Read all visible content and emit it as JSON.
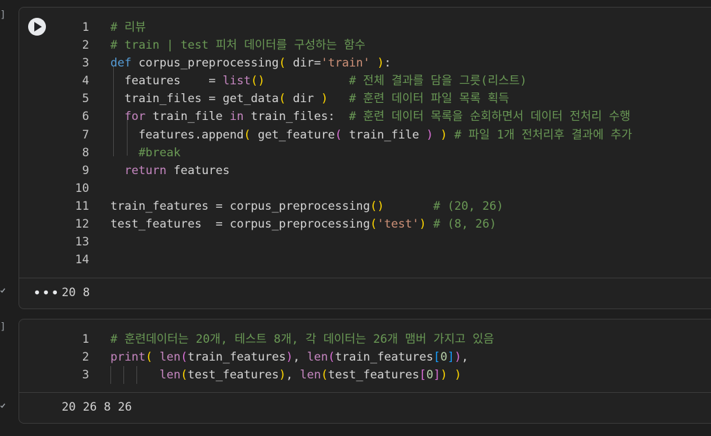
{
  "gutter": {
    "bracket": "]"
  },
  "cell1": {
    "lines": [
      {
        "n": "1",
        "t": "# 리뷰"
      },
      {
        "n": "2",
        "t": "# train | test 피처 데이터를 구성하는 함수"
      },
      {
        "n": "3",
        "t": "def corpus_preprocessing( dir='train' ):"
      },
      {
        "n": "4",
        "t": "  features    = list()            # 전체 결과를 담을 그릇(리스트)"
      },
      {
        "n": "5",
        "t": "  train_files = get_data( dir )   # 훈련 데이터 파일 목록 획득"
      },
      {
        "n": "6",
        "t": "  for train_file in train_files:  # 훈련 데이터 목록을 순회하면서 데이터 전처리 수행"
      },
      {
        "n": "7",
        "t": "    features.append( get_feature( train_file ) ) # 파일 1개 전처리후 결과에 추가"
      },
      {
        "n": "8",
        "t": "    #break"
      },
      {
        "n": "9",
        "t": "  return features"
      },
      {
        "n": "10",
        "t": ""
      },
      {
        "n": "11",
        "t": "train_features = corpus_preprocessing()       # (20, 26)"
      },
      {
        "n": "12",
        "t": "test_features  = corpus_preprocessing('test') # (8, 26)"
      },
      {
        "n": "13",
        "t": ""
      },
      {
        "n": "14",
        "t": ""
      }
    ],
    "output_menu": "•••",
    "output": "20 8"
  },
  "cell2": {
    "lines": [
      {
        "n": "1",
        "t": "# 훈련데이터는 20개, 테스트 8개, 각 데이터는 26개 맴버 가지고 있음"
      },
      {
        "n": "2",
        "t": "print( len(train_features), len(train_features[0]),"
      },
      {
        "n": "3",
        "t": "       len(test_features), len(test_features[0]) )"
      }
    ],
    "output": "20 26 8 26"
  }
}
